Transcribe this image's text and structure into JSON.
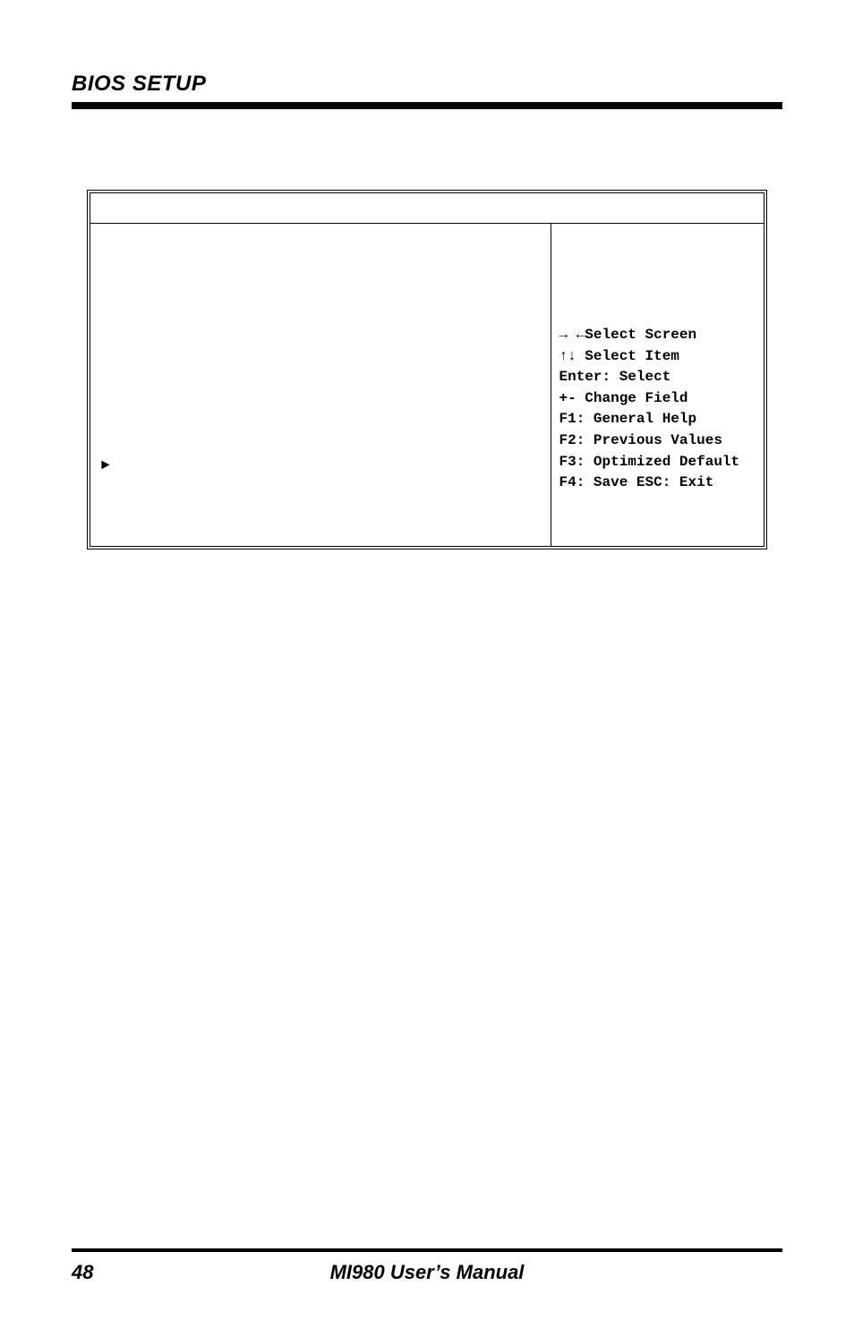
{
  "header": {
    "title": "BIOS SETUP"
  },
  "bios": {
    "pointer": "►",
    "help": {
      "l1": "→ ←Select Screen",
      "l2": "↑↓ Select Item",
      "l3": "Enter: Select",
      "l4": "+-  Change Field",
      "l5": "F1: General Help",
      "l6": "F2: Previous Values",
      "l7": "F3: Optimized Default",
      "l8": "F4: Save  ESC: Exit"
    }
  },
  "footer": {
    "page": "48",
    "manual": "MI980 User’s Manual"
  }
}
